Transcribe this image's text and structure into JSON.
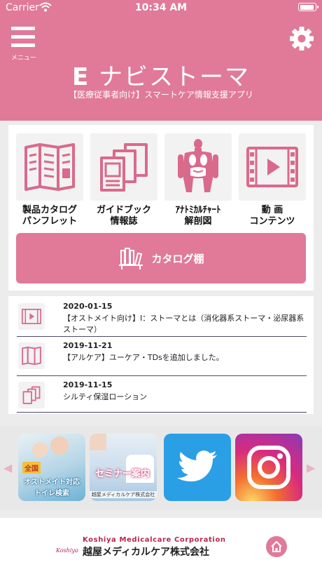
{
  "status_bar": {
    "carrier": "Carrier",
    "time": "10:34 AM"
  },
  "header": {
    "menu_label": "メニュー",
    "title_e": "E",
    "title_rest": "ナビストーマ",
    "subtitle": "【医療従事者向け】スマートケア情報支援アプリ"
  },
  "tiles": [
    {
      "icon": "catalog-pamphlet-icon",
      "line1": "製品カタログ",
      "line2": "パンフレット"
    },
    {
      "icon": "guidebook-icon",
      "line1": "ガイドブック",
      "line2": "情報誌"
    },
    {
      "icon": "anatomy-icon",
      "line1": "ｱﾅﾄﾐｶﾙﾁｬｰﾄ",
      "line2": "解剖図"
    },
    {
      "icon": "video-icon",
      "line1": "動 画",
      "line2": "コンテンツ"
    }
  ],
  "catalog_shelf": {
    "label": "カタログ棚",
    "icon": "bookshelf-icon"
  },
  "news": [
    {
      "icon": "video-icon",
      "date": "2020-01-15",
      "text": "【オストメイト向け】Ⅰ：ストーマとは（消化器系ストーマ・泌尿器系ストーマ）"
    },
    {
      "icon": "catalog-pamphlet-icon",
      "date": "2019-11-21",
      "text": "【アルケア】ユーケア・TDsを追加しました。"
    },
    {
      "icon": "guidebook-icon",
      "date": "2019-11-15",
      "text": "シルティ保湿ローション"
    }
  ],
  "banners": {
    "banner1": {
      "tag": "全国",
      "line1": "オストメイト対応",
      "line2": "トイレ検索"
    },
    "banner2": {
      "title": "セミナー案内",
      "company": "越屋メディカルケア株式会社"
    },
    "banner3": {
      "icon": "twitter-icon"
    },
    "banner4": {
      "icon": "instagram-icon"
    }
  },
  "footer": {
    "company_en": "Koshiya Medicalcare Corporation",
    "company_jp": "越屋メディカルケア株式会社",
    "logo_text": "Koshiya"
  },
  "colors": {
    "brand_pink": "#e07a98",
    "background": "#ececec"
  }
}
